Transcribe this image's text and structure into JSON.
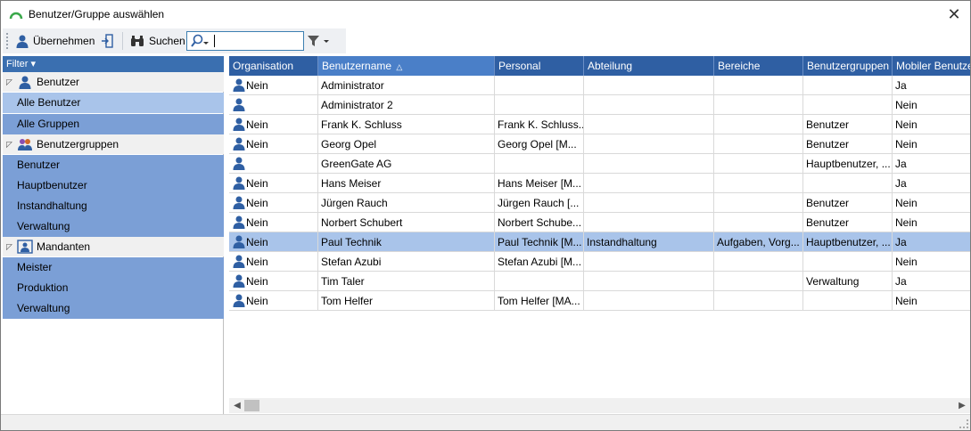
{
  "window": {
    "title": "Benutzer/Gruppe auswählen",
    "close_glyph": "✕"
  },
  "toolbar": {
    "apply_label": "Übernehmen",
    "search_label": "Suchen",
    "search_value": ""
  },
  "filter": {
    "label": "Filter ▾",
    "groups": [
      {
        "name": "Benutzer",
        "icon": "user-icon",
        "items": [
          {
            "label": "Alle Benutzer",
            "selected": true
          },
          {
            "label": "Alle Gruppen",
            "selected": false
          }
        ]
      },
      {
        "name": "Benutzergruppen",
        "icon": "user-group-icon",
        "items": [
          {
            "label": "Benutzer",
            "selected": false
          },
          {
            "label": "Hauptbenutzer",
            "selected": false
          },
          {
            "label": "Instandhaltung",
            "selected": false
          },
          {
            "label": "Verwaltung",
            "selected": false
          }
        ]
      },
      {
        "name": "Mandanten",
        "icon": "client-icon",
        "items": [
          {
            "label": "Meister",
            "selected": false
          },
          {
            "label": "Produktion",
            "selected": false
          },
          {
            "label": "Verwaltung",
            "selected": false
          }
        ]
      }
    ]
  },
  "grid": {
    "columns": [
      "Organisation",
      "Benutzername",
      "Personal",
      "Abteilung",
      "Bereiche",
      "Benutzergruppen",
      "Mobiler Benutzer"
    ],
    "sort_indicator": "△",
    "rows": [
      [
        "Nein",
        "Administrator",
        "",
        "",
        "",
        "",
        "Ja"
      ],
      [
        "",
        "Administrator 2",
        "",
        "",
        "",
        "",
        "Nein"
      ],
      [
        "Nein",
        "Frank K. Schluss",
        "Frank K. Schluss...",
        "",
        "",
        "Benutzer",
        "Nein"
      ],
      [
        "Nein",
        "Georg Opel",
        "Georg Opel [M...",
        "",
        "",
        "Benutzer",
        "Nein"
      ],
      [
        "",
        "GreenGate AG",
        "",
        "",
        "",
        "Hauptbenutzer, ...",
        "Ja"
      ],
      [
        "Nein",
        "Hans Meiser",
        "Hans Meiser [M...",
        "",
        "",
        "",
        "Ja"
      ],
      [
        "Nein",
        "Jürgen Rauch",
        "Jürgen Rauch [...",
        "",
        "",
        "Benutzer",
        "Nein"
      ],
      [
        "Nein",
        "Norbert Schubert",
        "Norbert Schube...",
        "",
        "",
        "Benutzer",
        "Nein"
      ],
      [
        "Nein",
        "Paul Technik",
        "Paul Technik [M...",
        "Instandhaltung",
        "Aufgaben, Vorg...",
        "Hauptbenutzer, ...",
        "Ja"
      ],
      [
        "Nein",
        "Stefan Azubi",
        "Stefan Azubi [M...",
        "",
        "",
        "",
        "Nein"
      ],
      [
        "Nein",
        "Tim Taler",
        "",
        "",
        "",
        "Verwaltung",
        "Ja"
      ],
      [
        "Nein",
        "Tom Helfer",
        "Tom Helfer [MA...",
        "",
        "",
        "",
        "Nein"
      ]
    ],
    "selected_row": 8
  },
  "colors": {
    "header": "#2f5fa3",
    "selection": "#a9c4ea",
    "group_item": "#7b9fd6",
    "accent": "#3a6fb0"
  }
}
